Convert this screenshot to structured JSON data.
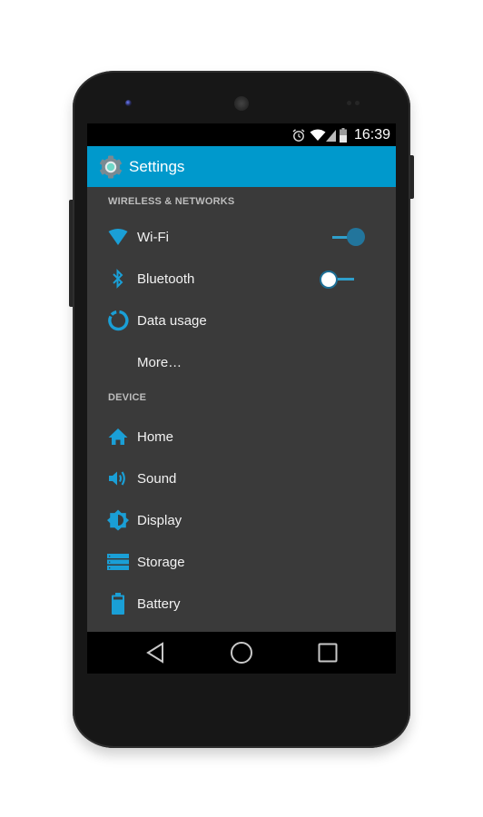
{
  "status_bar": {
    "time": "16:39",
    "icons": [
      "alarm-icon",
      "wifi-signal-icon",
      "cell-signal-icon",
      "battery-icon"
    ]
  },
  "app_bar": {
    "title": "Settings",
    "icon": "settings-gear-icon"
  },
  "sections": [
    {
      "header": "WIRELESS & NETWORKS",
      "items": [
        {
          "label": "Wi-Fi",
          "icon": "wifi-icon",
          "toggle": true
        },
        {
          "label": "Bluetooth",
          "icon": "bluetooth-icon",
          "toggle": false
        },
        {
          "label": "Data usage",
          "icon": "data-usage-icon"
        },
        {
          "label": "More…",
          "icon": null
        }
      ]
    },
    {
      "header": "DEVICE",
      "items": [
        {
          "label": "Home",
          "icon": "home-icon"
        },
        {
          "label": "Sound",
          "icon": "sound-icon"
        },
        {
          "label": "Display",
          "icon": "display-icon"
        },
        {
          "label": "Storage",
          "icon": "storage-icon"
        },
        {
          "label": "Battery",
          "icon": "battery-item-icon"
        }
      ]
    }
  ],
  "nav_bar": {
    "buttons": [
      "back-icon",
      "home-nav-icon",
      "recents-icon"
    ]
  },
  "colors": {
    "accent": "#0099cc",
    "icon": "#1a9fd6",
    "background": "#3a3a3a",
    "switch_on_thumb": "#22759c"
  }
}
